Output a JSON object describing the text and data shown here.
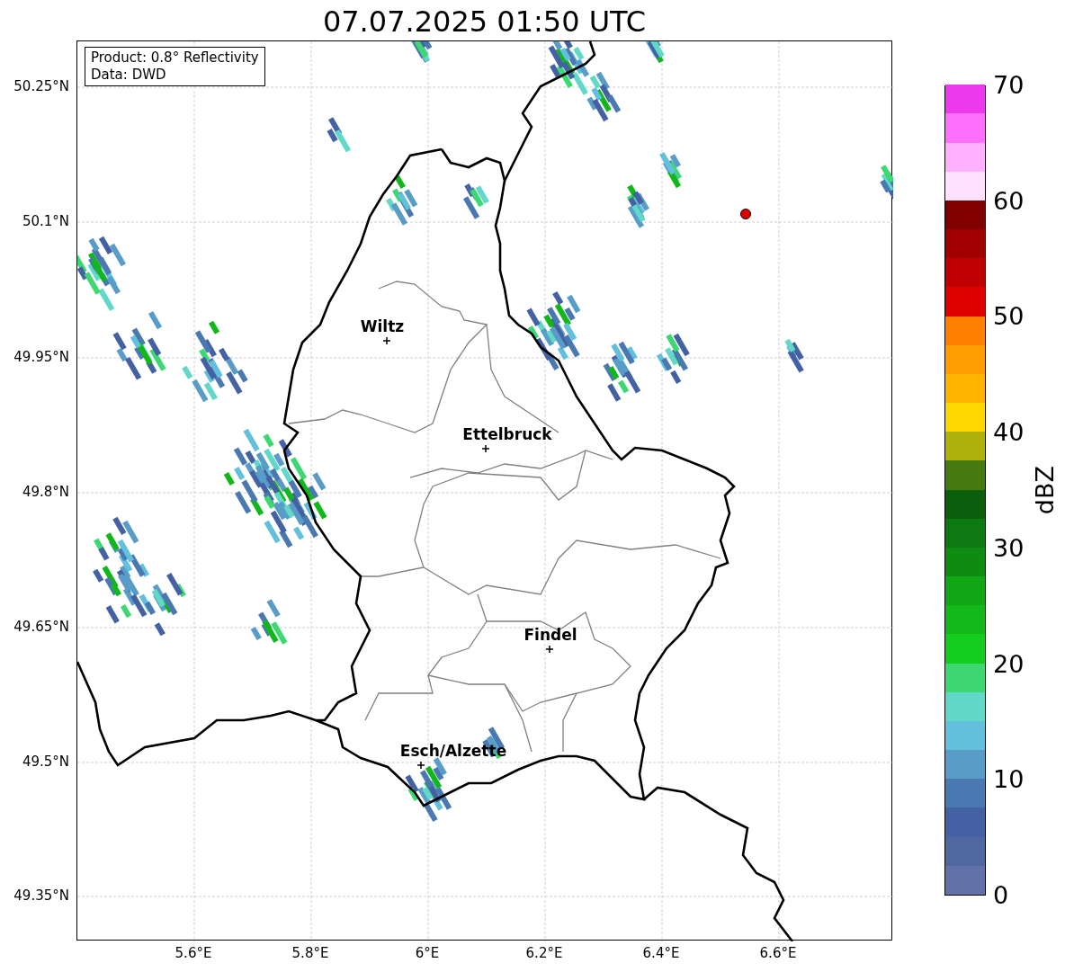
{
  "title": "07.07.2025 01:50 UTC",
  "info_box": [
    "Product: 0.8° Reflectivity",
    "Data: DWD"
  ],
  "lat_labels": [
    "50.25°N",
    "50.1°N",
    "49.95°N",
    "49.8°N",
    "49.65°N",
    "49.5°N",
    "49.35°N"
  ],
  "lon_labels": [
    "5.6°E",
    "5.8°E",
    "6°E",
    "6.2°E",
    "6.4°E",
    "6.6°E"
  ],
  "cities": [
    {
      "name": "Wiltz"
    },
    {
      "name": "Ettelbruck"
    },
    {
      "name": "Findel"
    },
    {
      "name": "Esch/Alzette"
    }
  ],
  "colorbar": {
    "label": "dBZ",
    "ticks": [
      "70",
      "60",
      "50",
      "40",
      "30",
      "20",
      "10",
      "0"
    ],
    "bins": [
      {
        "color": "#6272a8"
      },
      {
        "color": "#5068a0"
      },
      {
        "color": "#4461a3"
      },
      {
        "color": "#4a78b0"
      },
      {
        "color": "#5a9cc8"
      },
      {
        "color": "#62c0dc"
      },
      {
        "color": "#62d8c8"
      },
      {
        "color": "#3ed872"
      },
      {
        "color": "#14cc1e"
      },
      {
        "color": "#12b81a"
      },
      {
        "color": "#10a614"
      },
      {
        "color": "#0e8c12"
      },
      {
        "color": "#0c7a10"
      },
      {
        "color": "#0a5e0c"
      },
      {
        "color": "#457a10"
      },
      {
        "color": "#b0b00a"
      },
      {
        "color": "#ffd700"
      },
      {
        "color": "#ffb400"
      },
      {
        "color": "#ff9c00"
      },
      {
        "color": "#ff8000"
      },
      {
        "color": "#e00000"
      },
      {
        "color": "#c00000"
      },
      {
        "color": "#a00000"
      },
      {
        "color": "#800000"
      },
      {
        "color": "#ffe0ff"
      },
      {
        "color": "#ffb0ff"
      },
      {
        "color": "#ff70ff"
      },
      {
        "color": "#ee38ee"
      }
    ]
  }
}
